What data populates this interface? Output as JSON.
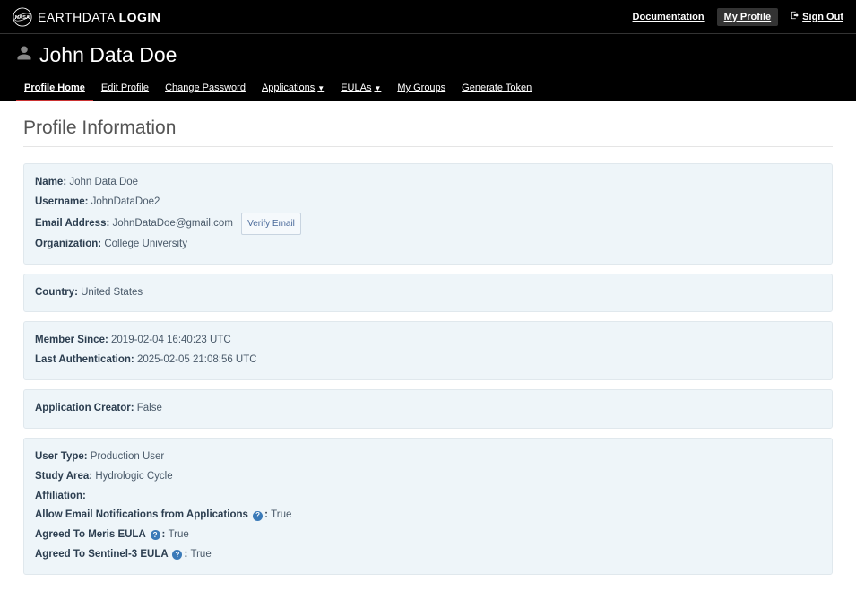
{
  "header": {
    "brand_a": "EARTHDATA",
    "brand_b": "LOGIN",
    "links": {
      "documentation": "Documentation",
      "my_profile": "My Profile",
      "sign_out": "Sign Out"
    }
  },
  "user": {
    "display_name": "John Data Doe"
  },
  "tabs": {
    "profile_home": "Profile Home",
    "edit_profile": "Edit Profile",
    "change_password": "Change Password",
    "applications": "Applications",
    "eulas": "EULAs",
    "my_groups": "My Groups",
    "generate_token": "Generate Token"
  },
  "page": {
    "title": "Profile Information"
  },
  "profile": {
    "name_label": "Name:",
    "name_value": "John Data Doe",
    "username_label": "Username:",
    "username_value": "JohnDataDoe2",
    "email_label": "Email Address:",
    "email_value": "JohnDataDoe@gmail.com",
    "verify_email": "Verify Email",
    "org_label": "Organization:",
    "org_value": "College University",
    "country_label": "Country:",
    "country_value": "United States",
    "member_since_label": "Member Since:",
    "member_since_value": "2019-02-04 16:40:23 UTC",
    "last_auth_label": "Last Authentication:",
    "last_auth_value": "2025-02-05 21:08:56 UTC",
    "app_creator_label": "Application Creator:",
    "app_creator_value": "False",
    "user_type_label": "User Type:",
    "user_type_value": "Production User",
    "study_area_label": "Study Area:",
    "study_area_value": "Hydrologic Cycle",
    "affiliation_label": "Affiliation:",
    "affiliation_value": "",
    "allow_email_label": "Allow Email Notifications from Applications",
    "allow_email_value": "True",
    "meris_label": "Agreed To Meris EULA",
    "meris_value": "True",
    "sentinel_label": "Agreed To Sentinel-3 EULA",
    "sentinel_value": "True",
    "help_glyph": "?",
    "colon": ":"
  }
}
